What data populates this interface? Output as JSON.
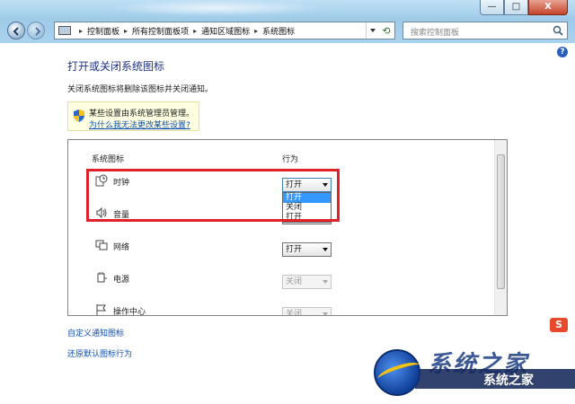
{
  "window": {
    "minimize_label": "—",
    "maximize_label": "□",
    "close_label": "X"
  },
  "address_bar": {
    "separator": "▸",
    "breadcrumbs": [
      "控制面板",
      "所有控制面板项",
      "通知区域图标",
      "系统图标"
    ]
  },
  "search": {
    "placeholder": "搜索控制面板"
  },
  "page": {
    "title": "打开或关闭系统图标",
    "description": "关闭系统图标将删除该图标并关闭通知。",
    "notice_text": "某些设置由系统管理员管理。",
    "notice_link": "为什么我无法更改某些设置?"
  },
  "table": {
    "headers": {
      "icon": "系统图标",
      "behavior": "行为"
    },
    "rows": [
      {
        "name": "时钟",
        "icon": "clock-icon",
        "value": "打开",
        "enabled": true
      },
      {
        "name": "音量",
        "icon": "volume-icon",
        "value": "打开",
        "enabled": true
      },
      {
        "name": "网络",
        "icon": "network-icon",
        "value": "打开",
        "enabled": true
      },
      {
        "name": "电源",
        "icon": "power-icon",
        "value": "关闭",
        "enabled": false
      },
      {
        "name": "操作中心",
        "icon": "action-center-flag-icon",
        "value": "关闭",
        "enabled": false
      }
    ],
    "dropdown_options": [
      "打开",
      "关闭"
    ],
    "dropdown_selected": "打开"
  },
  "links": {
    "customize": "自定义通知图标",
    "restore": "还原默认图标行为"
  },
  "watermark": {
    "big_text": "系统之家",
    "text": "系统之家",
    "ime_label": "S"
  },
  "colors": {
    "highlight": "#e0202a",
    "link": "#0b4fb5",
    "title": "#1e3287",
    "selection": "#3399ff"
  }
}
